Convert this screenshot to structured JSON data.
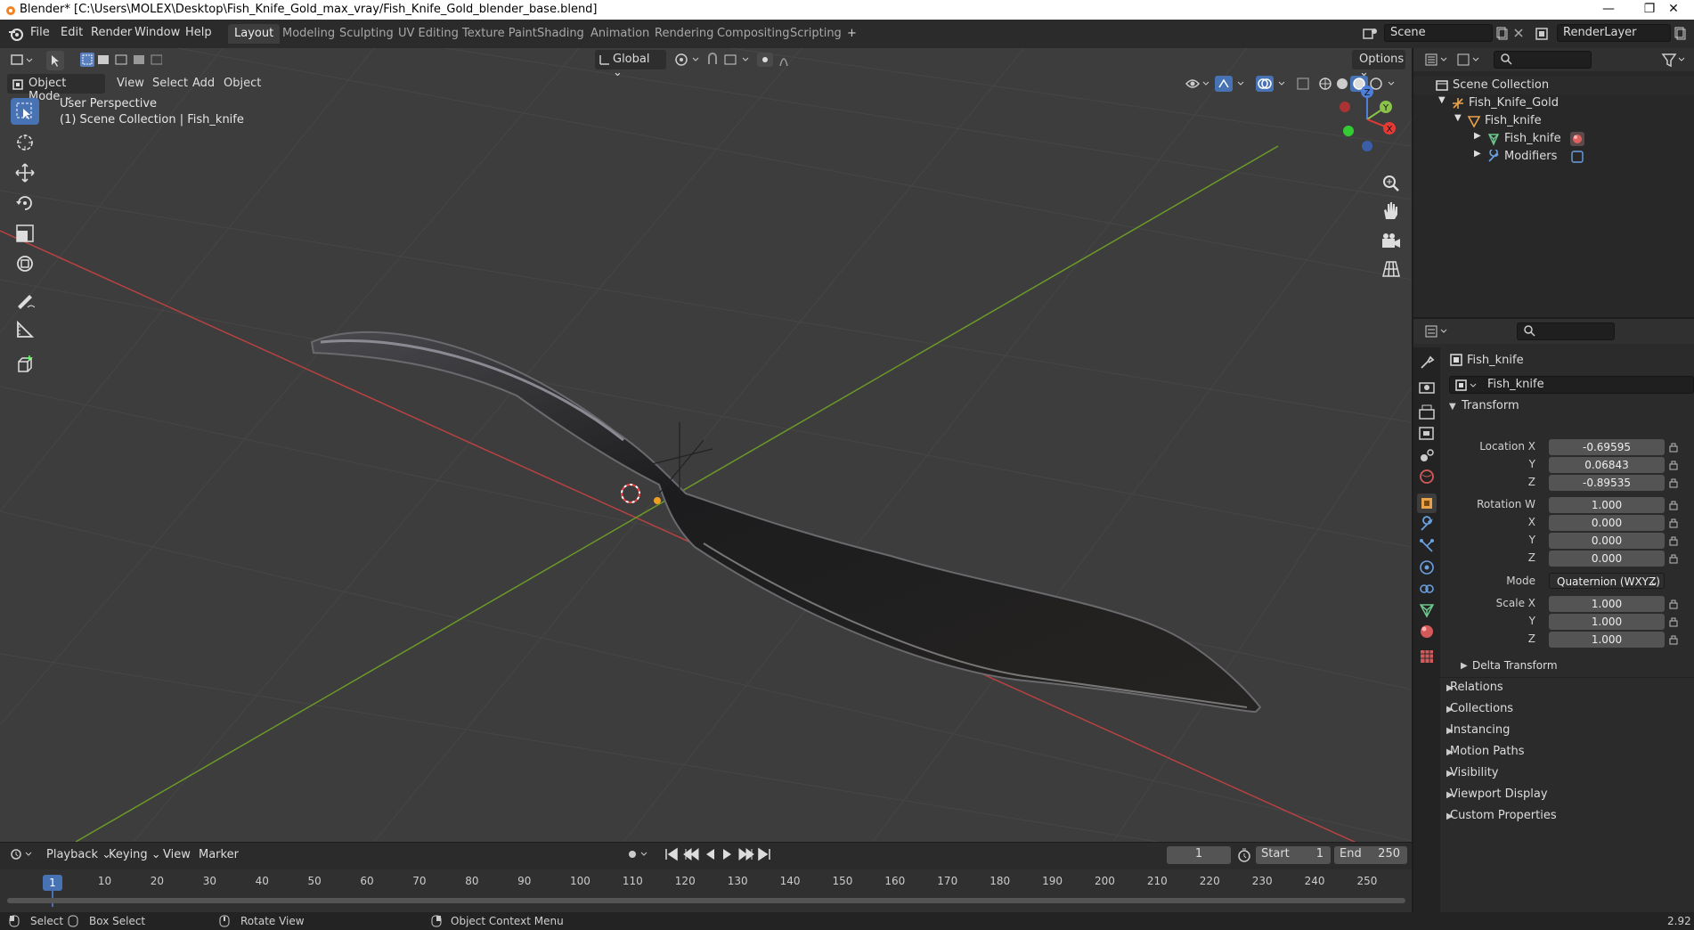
{
  "window": {
    "title": "Blender* [C:\\Users\\MOLEX\\Desktop\\Fish_Knife_Gold_max_vray/Fish_Knife_Gold_blender_base.blend]",
    "minimize": "—",
    "maximize": "❐",
    "close": "✕"
  },
  "menu": [
    "File",
    "Edit",
    "Render",
    "Window",
    "Help"
  ],
  "workspaces": [
    "Layout",
    "Modeling",
    "Sculpting",
    "UV Editing",
    "Texture Paint",
    "Shading",
    "Animation",
    "Rendering",
    "Compositing",
    "Scripting"
  ],
  "add_workspace": "+",
  "scene": {
    "name": "Scene",
    "render_layer": "RenderLayer"
  },
  "viewport": {
    "mode": "Object Mode",
    "menus": [
      "View",
      "Select",
      "Add",
      "Object"
    ],
    "transform_orientation": "Global",
    "options": "Options",
    "view_name": "User Perspective",
    "collection_info": "(1) Scene Collection | Fish_knife",
    "gizmo": {
      "x": "X",
      "y": "Y",
      "z": "Z"
    }
  },
  "outliner": {
    "search_placeholder": "",
    "items": [
      {
        "label": "Scene Collection",
        "indent": 0
      },
      {
        "label": "Fish_Knife_Gold",
        "indent": 1
      },
      {
        "label": "Fish_knife",
        "indent": 2
      },
      {
        "label": "Fish_knife",
        "indent": 3
      },
      {
        "label": "Modifiers",
        "indent": 3
      }
    ]
  },
  "properties": {
    "object_name": "Fish_knife",
    "object_field": "Fish_knife",
    "transform": {
      "header": "Transform",
      "location_label": "Location X",
      "location": [
        "-0.69595",
        "0.06843",
        "-0.89535"
      ],
      "rotation_label": "Rotation W",
      "rotation": [
        "1.000",
        "0.000",
        "0.000",
        "0.000"
      ],
      "mode_label": "Mode",
      "mode": "Quaternion (WXYZ)",
      "scale_label": "Scale X",
      "scale": [
        "1.000",
        "1.000",
        "1.000"
      ],
      "axis": [
        "Y",
        "Z",
        "X"
      ]
    },
    "delta_transform": "Delta Transform",
    "panels": [
      "Relations",
      "Collections",
      "Instancing",
      "Motion Paths",
      "Visibility",
      "Viewport Display",
      "Custom Properties"
    ]
  },
  "timeline": {
    "menus": [
      "Playback",
      "Keying",
      "View",
      "Marker"
    ],
    "current_frame": "1",
    "start_label": "Start",
    "start": "1",
    "end_label": "End",
    "end": "250",
    "ticks": [
      "10",
      "20",
      "30",
      "40",
      "50",
      "60",
      "70",
      "80",
      "90",
      "100",
      "110",
      "120",
      "130",
      "140",
      "150",
      "160",
      "170",
      "180",
      "190",
      "200",
      "210",
      "220",
      "230",
      "240",
      "250"
    ],
    "playhead": "1"
  },
  "status": {
    "select": "Select",
    "box_select": "Box Select",
    "rotate_view": "Rotate View",
    "context_menu": "Object Context Menu",
    "version": "2.92"
  }
}
